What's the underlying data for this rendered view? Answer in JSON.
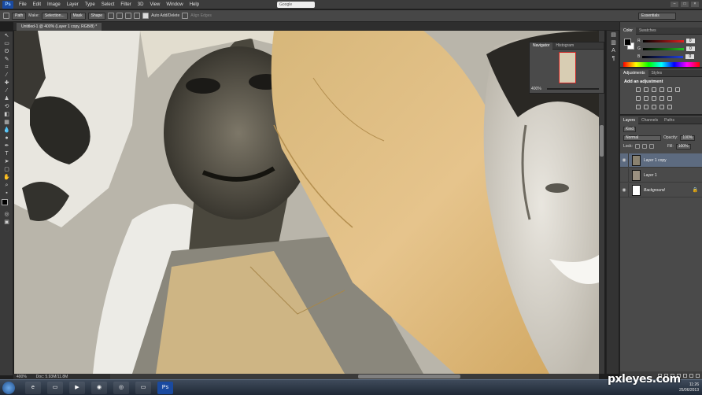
{
  "app": {
    "logo": "Ps",
    "search_placeholder": "Google"
  },
  "menu": [
    "File",
    "Edit",
    "Image",
    "Layer",
    "Type",
    "Select",
    "Filter",
    "3D",
    "View",
    "Window",
    "Help"
  ],
  "options": {
    "mode": "Path",
    "make_label": "Make:",
    "selection_btn": "Selection...",
    "mask_btn": "Mask",
    "shape_btn": "Shape",
    "auto_add_delete": "Auto Add/Delete",
    "align_edges": "Align Edges",
    "workspace": "Essentials"
  },
  "document": {
    "tab_title": "Untitled-1 @ 400% (Layer 1 copy, RGB/8) *"
  },
  "status": {
    "zoom": "400%",
    "doc_size": "Doc: 5.93M/11.8M"
  },
  "navigator": {
    "tabs": [
      "Navigator",
      "Histogram"
    ],
    "zoom": "400%"
  },
  "color": {
    "tabs": [
      "Color",
      "Swatches"
    ],
    "channels": [
      {
        "label": "R",
        "value": "0",
        "color": "#e02020"
      },
      {
        "label": "G",
        "value": "0",
        "color": "#20c020"
      },
      {
        "label": "B",
        "value": "0",
        "color": "#2040e0"
      }
    ]
  },
  "adjustments": {
    "tabs": [
      "Adjustments",
      "Styles"
    ],
    "title": "Add an adjustment"
  },
  "layers": {
    "tabs": [
      "Layers",
      "Channels",
      "Paths"
    ],
    "kind": "Kind",
    "blend": "Normal",
    "opacity_label": "Opacity:",
    "opacity": "100%",
    "lock_label": "Lock:",
    "fill_label": "Fill:",
    "fill": "100%",
    "items": [
      {
        "name": "Layer 1 copy",
        "selected": true
      },
      {
        "name": "Layer 1",
        "selected": false
      },
      {
        "name": "Background",
        "selected": false
      }
    ]
  },
  "taskbar": {
    "time": "11:26",
    "date": "25/06/2013"
  },
  "watermark": "pxleyes.com"
}
